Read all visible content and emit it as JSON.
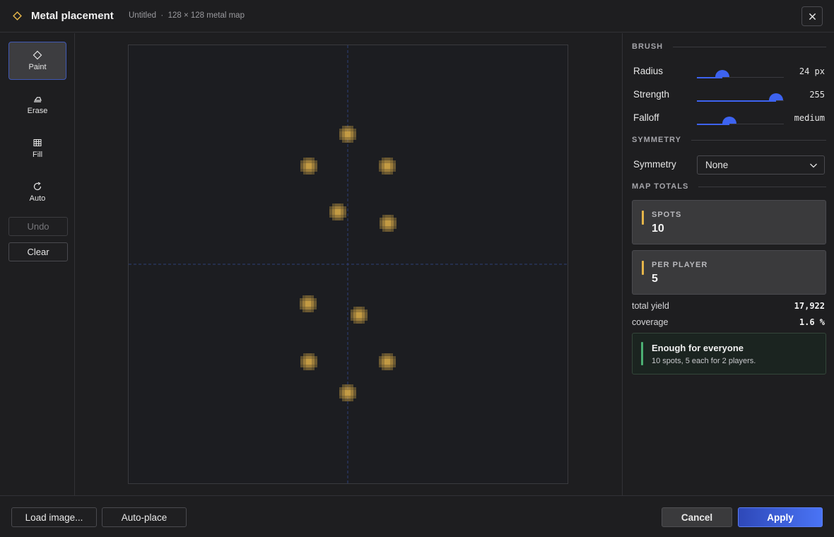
{
  "header": {
    "title": "Metal placement",
    "subtitle": "Untitled  ·  128 × 128 metal map",
    "icon": "diamond-icon",
    "accent_color": "#e5b54a",
    "close_icon": "close-icon"
  },
  "toolbar": {
    "tools": [
      {
        "label": "Paint",
        "icon": "diamond-icon",
        "active": true
      },
      {
        "label": "Erase",
        "icon": "eraser-icon",
        "active": false
      },
      {
        "label": "Fill",
        "icon": "grid-icon",
        "active": false
      },
      {
        "label": "Auto",
        "icon": "refresh-icon",
        "active": false
      }
    ],
    "undo_label": "Undo",
    "undo_enabled": false,
    "clear_label": "Clear"
  },
  "map": {
    "symmetry_guides": true,
    "spot_color": "#e5b54a"
  },
  "brush": {
    "heading": "BRUSH",
    "radius": {
      "label": "Radius",
      "value": "24 px",
      "level": 0.29
    },
    "strength": {
      "label": "Strength",
      "value": "255",
      "level": 1.0
    },
    "falloff": {
      "label": "Falloff",
      "value": "medium",
      "level": 0.37
    }
  },
  "symmetry": {
    "heading": "SYMMETRY",
    "label": "Symmetry",
    "selected": "None"
  },
  "totals": {
    "heading": "MAP TOTALS",
    "spots_label": "SPOTS",
    "spots_value": "10",
    "per_player_label": "PER PLAYER",
    "per_player_value": "5",
    "yield_label": "total yield",
    "yield_value": "17,922",
    "coverage_label": "coverage",
    "coverage_value": "1.6 %"
  },
  "notice": {
    "title": "Enough for everyone",
    "detail": "10 spots, 5 each for 2 players.",
    "color": "#4caf73"
  },
  "footer": {
    "load_label": "Load image...",
    "autoplace_label": "Auto-place",
    "cancel_label": "Cancel",
    "apply_label": "Apply",
    "apply_color": "#3d63f0"
  }
}
